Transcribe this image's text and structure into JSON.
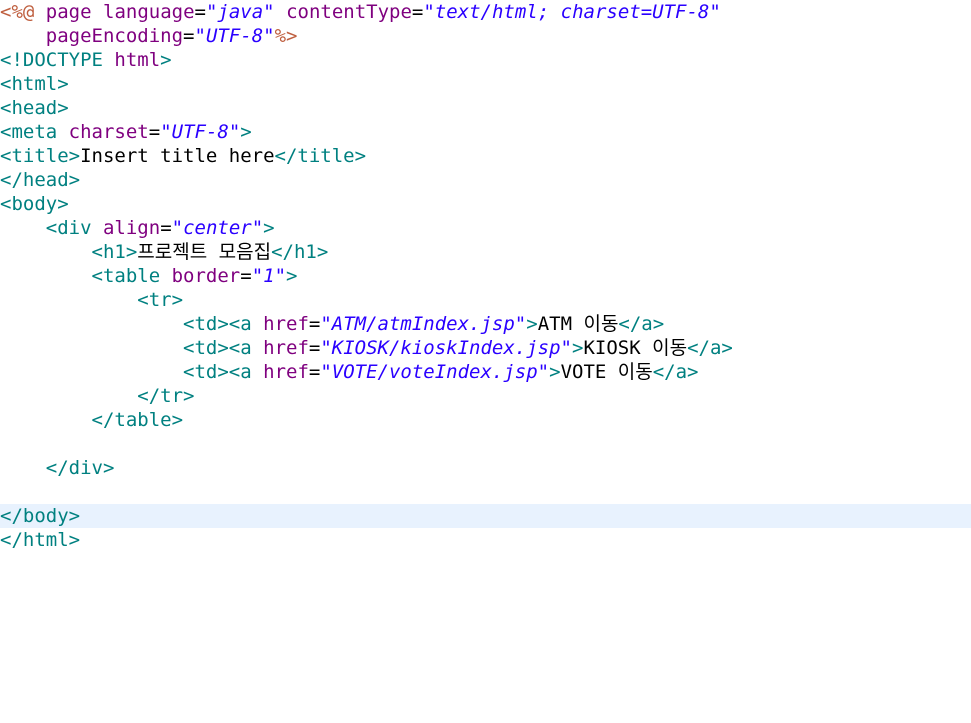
{
  "editor": {
    "lines": [
      [
        {
          "t": "<%@",
          "c": "jsp"
        },
        {
          "t": " ",
          "c": "text"
        },
        {
          "t": "page",
          "c": "attr"
        },
        {
          "t": " ",
          "c": "text"
        },
        {
          "t": "language",
          "c": "attr"
        },
        {
          "t": "=",
          "c": "text"
        },
        {
          "t": "\"java\"",
          "c": "val"
        },
        {
          "t": " ",
          "c": "text"
        },
        {
          "t": "contentType",
          "c": "attr"
        },
        {
          "t": "=",
          "c": "text"
        },
        {
          "t": "\"text/html; charset=UTF-8\"",
          "c": "val"
        }
      ],
      [
        {
          "t": "    ",
          "c": "text"
        },
        {
          "t": "pageEncoding",
          "c": "attr"
        },
        {
          "t": "=",
          "c": "text"
        },
        {
          "t": "\"UTF-8\"",
          "c": "val"
        },
        {
          "t": "%>",
          "c": "jsp"
        }
      ],
      [
        {
          "t": "<!DOCTYPE",
          "c": "tag"
        },
        {
          "t": " ",
          "c": "text"
        },
        {
          "t": "html",
          "c": "attr"
        },
        {
          "t": ">",
          "c": "tag"
        }
      ],
      [
        {
          "t": "<html>",
          "c": "tag"
        }
      ],
      [
        {
          "t": "<head>",
          "c": "tag"
        }
      ],
      [
        {
          "t": "<meta",
          "c": "tag"
        },
        {
          "t": " ",
          "c": "text"
        },
        {
          "t": "charset",
          "c": "attr"
        },
        {
          "t": "=",
          "c": "text"
        },
        {
          "t": "\"UTF-8\"",
          "c": "val"
        },
        {
          "t": ">",
          "c": "tag"
        }
      ],
      [
        {
          "t": "<title>",
          "c": "tag"
        },
        {
          "t": "Insert title here",
          "c": "text"
        },
        {
          "t": "</title>",
          "c": "tag"
        }
      ],
      [
        {
          "t": "</head>",
          "c": "tag"
        }
      ],
      [
        {
          "t": "<body>",
          "c": "tag"
        }
      ],
      [
        {
          "t": "    ",
          "c": "text"
        },
        {
          "t": "<div",
          "c": "tag"
        },
        {
          "t": " ",
          "c": "text"
        },
        {
          "t": "align",
          "c": "attr"
        },
        {
          "t": "=",
          "c": "text"
        },
        {
          "t": "\"center\"",
          "c": "val"
        },
        {
          "t": ">",
          "c": "tag"
        }
      ],
      [
        {
          "t": "        ",
          "c": "text"
        },
        {
          "t": "<h1>",
          "c": "tag"
        },
        {
          "t": "프로젝트 모음집",
          "c": "text"
        },
        {
          "t": "</h1>",
          "c": "tag"
        }
      ],
      [
        {
          "t": "        ",
          "c": "text"
        },
        {
          "t": "<table",
          "c": "tag"
        },
        {
          "t": " ",
          "c": "text"
        },
        {
          "t": "border",
          "c": "attr"
        },
        {
          "t": "=",
          "c": "text"
        },
        {
          "t": "\"1\"",
          "c": "val"
        },
        {
          "t": ">",
          "c": "tag"
        }
      ],
      [
        {
          "t": "            ",
          "c": "text"
        },
        {
          "t": "<tr>",
          "c": "tag"
        }
      ],
      [
        {
          "t": "                ",
          "c": "text"
        },
        {
          "t": "<td><a",
          "c": "tag"
        },
        {
          "t": " ",
          "c": "text"
        },
        {
          "t": "href",
          "c": "attr"
        },
        {
          "t": "=",
          "c": "text"
        },
        {
          "t": "\"ATM/atmIndex.jsp\"",
          "c": "val"
        },
        {
          "t": ">",
          "c": "tag"
        },
        {
          "t": "ATM 이동",
          "c": "text"
        },
        {
          "t": "</a>",
          "c": "tag"
        }
      ],
      [
        {
          "t": "                ",
          "c": "text"
        },
        {
          "t": "<td><a",
          "c": "tag"
        },
        {
          "t": " ",
          "c": "text"
        },
        {
          "t": "href",
          "c": "attr"
        },
        {
          "t": "=",
          "c": "text"
        },
        {
          "t": "\"KIOSK/kioskIndex.jsp\"",
          "c": "val"
        },
        {
          "t": ">",
          "c": "tag"
        },
        {
          "t": "KIOSK 이동",
          "c": "text"
        },
        {
          "t": "</a>",
          "c": "tag"
        }
      ],
      [
        {
          "t": "                ",
          "c": "text"
        },
        {
          "t": "<td><a",
          "c": "tag"
        },
        {
          "t": " ",
          "c": "text"
        },
        {
          "t": "href",
          "c": "attr"
        },
        {
          "t": "=",
          "c": "text"
        },
        {
          "t": "\"VOTE/voteIndex.jsp\"",
          "c": "val"
        },
        {
          "t": ">",
          "c": "tag"
        },
        {
          "t": "VOTE 이동",
          "c": "text"
        },
        {
          "t": "</a>",
          "c": "tag"
        }
      ],
      [
        {
          "t": "            ",
          "c": "text"
        },
        {
          "t": "</tr>",
          "c": "tag"
        }
      ],
      [
        {
          "t": "        ",
          "c": "text"
        },
        {
          "t": "</table>",
          "c": "tag"
        }
      ],
      [],
      [
        {
          "t": "    ",
          "c": "text"
        },
        {
          "t": "</div>",
          "c": "tag"
        }
      ],
      [],
      [
        {
          "t": "</body>",
          "c": "tag"
        }
      ],
      [
        {
          "t": "</html>",
          "c": "tag"
        }
      ]
    ],
    "current_line_index": 21
  }
}
